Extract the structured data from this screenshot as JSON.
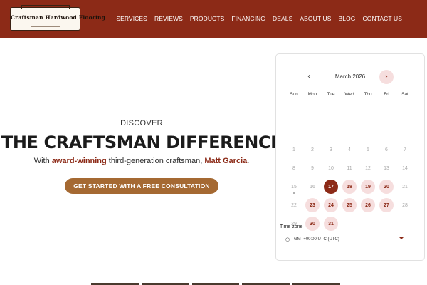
{
  "header": {
    "logo_text": "Craftsman Hardwood Flooring",
    "nav": [
      "SERVICES",
      "REVIEWS",
      "PRODUCTS",
      "FINANCING",
      "DEALS",
      "ABOUT US",
      "BLOG",
      "CONTACT US"
    ]
  },
  "hero": {
    "eyebrow": "DISCOVER",
    "title": "THE CRAFTSMAN DIFFERENCE",
    "sub_prefix": "With ",
    "sub_accent1": "award-winning",
    "sub_middle": " third-generation craftsman, ",
    "sub_accent2": "Matt Garcia",
    "sub_suffix": ".",
    "cta_label": "GET STARTED WITH A FREE CONSULTATION"
  },
  "calendar": {
    "month_label": "March 2026",
    "weekdays": [
      "Sun",
      "Mon",
      "Tue",
      "Wed",
      "Thu",
      "Fri",
      "Sat"
    ],
    "days": [
      {
        "d": "",
        "s": "blank"
      },
      {
        "d": "",
        "s": "blank"
      },
      {
        "d": "",
        "s": "blank"
      },
      {
        "d": "",
        "s": "blank"
      },
      {
        "d": "",
        "s": "blank"
      },
      {
        "d": "",
        "s": "blank"
      },
      {
        "d": "",
        "s": "blank"
      },
      {
        "d": "1",
        "s": "muted"
      },
      {
        "d": "2",
        "s": "muted"
      },
      {
        "d": "3",
        "s": "muted"
      },
      {
        "d": "4",
        "s": "muted"
      },
      {
        "d": "5",
        "s": "muted"
      },
      {
        "d": "6",
        "s": "muted"
      },
      {
        "d": "7",
        "s": "muted"
      },
      {
        "d": "8",
        "s": "muted"
      },
      {
        "d": "9",
        "s": "muted"
      },
      {
        "d": "10",
        "s": "muted"
      },
      {
        "d": "11",
        "s": "muted"
      },
      {
        "d": "12",
        "s": "muted"
      },
      {
        "d": "13",
        "s": "muted"
      },
      {
        "d": "14",
        "s": "muted"
      },
      {
        "d": "15",
        "s": "today"
      },
      {
        "d": "16",
        "s": "muted"
      },
      {
        "d": "17",
        "s": "selected"
      },
      {
        "d": "18",
        "s": "avail"
      },
      {
        "d": "19",
        "s": "avail"
      },
      {
        "d": "20",
        "s": "avail"
      },
      {
        "d": "21",
        "s": "muted"
      },
      {
        "d": "22",
        "s": "muted"
      },
      {
        "d": "23",
        "s": "avail"
      },
      {
        "d": "24",
        "s": "avail"
      },
      {
        "d": "25",
        "s": "avail"
      },
      {
        "d": "26",
        "s": "avail"
      },
      {
        "d": "27",
        "s": "avail"
      },
      {
        "d": "28",
        "s": "muted"
      },
      {
        "d": "29",
        "s": "muted"
      },
      {
        "d": "30",
        "s": "avail"
      },
      {
        "d": "31",
        "s": "avail"
      }
    ],
    "timezone_label": "Time zone",
    "timezone_value": "GMT+00:00 UTC (UTC)"
  },
  "colors": {
    "brand": "#8c2a17",
    "cta": "#a56932",
    "available_bg": "#f6dede"
  }
}
